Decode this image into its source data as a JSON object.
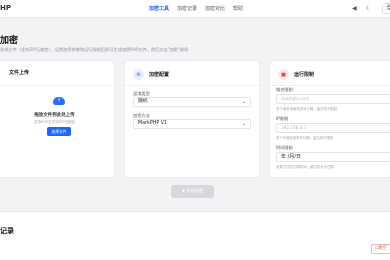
{
  "nav": {
    "logo": "HP",
    "links": [
      "加密工具",
      "加密记录",
      "加密对比",
      "帮助"
    ],
    "active_index": 0,
    "right_button": "登"
  },
  "page": {
    "title": "加密",
    "description": "选择文件（支持ZIP压缩包），设置加密参数和运行限制后即可生成加密PHP文件。然后点击\"加密\"继续"
  },
  "upload_card": {
    "title": "文件上传",
    "drop_title": "拖放文件到此处上传",
    "drop_hint": "支持PHP文件或ZIP压缩包",
    "select_button": "选择文件"
  },
  "config_card": {
    "title": "加密配置",
    "fields": [
      {
        "label": "混淆类型",
        "value": "随机"
      },
      {
        "label": "加密方法",
        "value": "MarkPHP V1"
      }
    ]
  },
  "limit_card": {
    "title": "运行限制",
    "fields": [
      {
        "label": "域名限制",
        "placeholder": "example.com",
        "hint": "多个域名请使用逗号分隔，留空则不限制"
      },
      {
        "label": "IP限制",
        "placeholder": "192.168.0.1",
        "hint": "多个IP请使用逗号分隔，留空则不限制"
      },
      {
        "label": "时间限制",
        "value": "年 /月/日",
        "hint": "设置文件的过期时间，留空则永不过期"
      }
    ]
  },
  "start_button": "开始加密",
  "records": {
    "title": "记录",
    "clear_button": "清空"
  },
  "colors": {
    "accent": "#1e64ff",
    "danger": "#e34b4b",
    "disabled": "#d6d8dc"
  }
}
